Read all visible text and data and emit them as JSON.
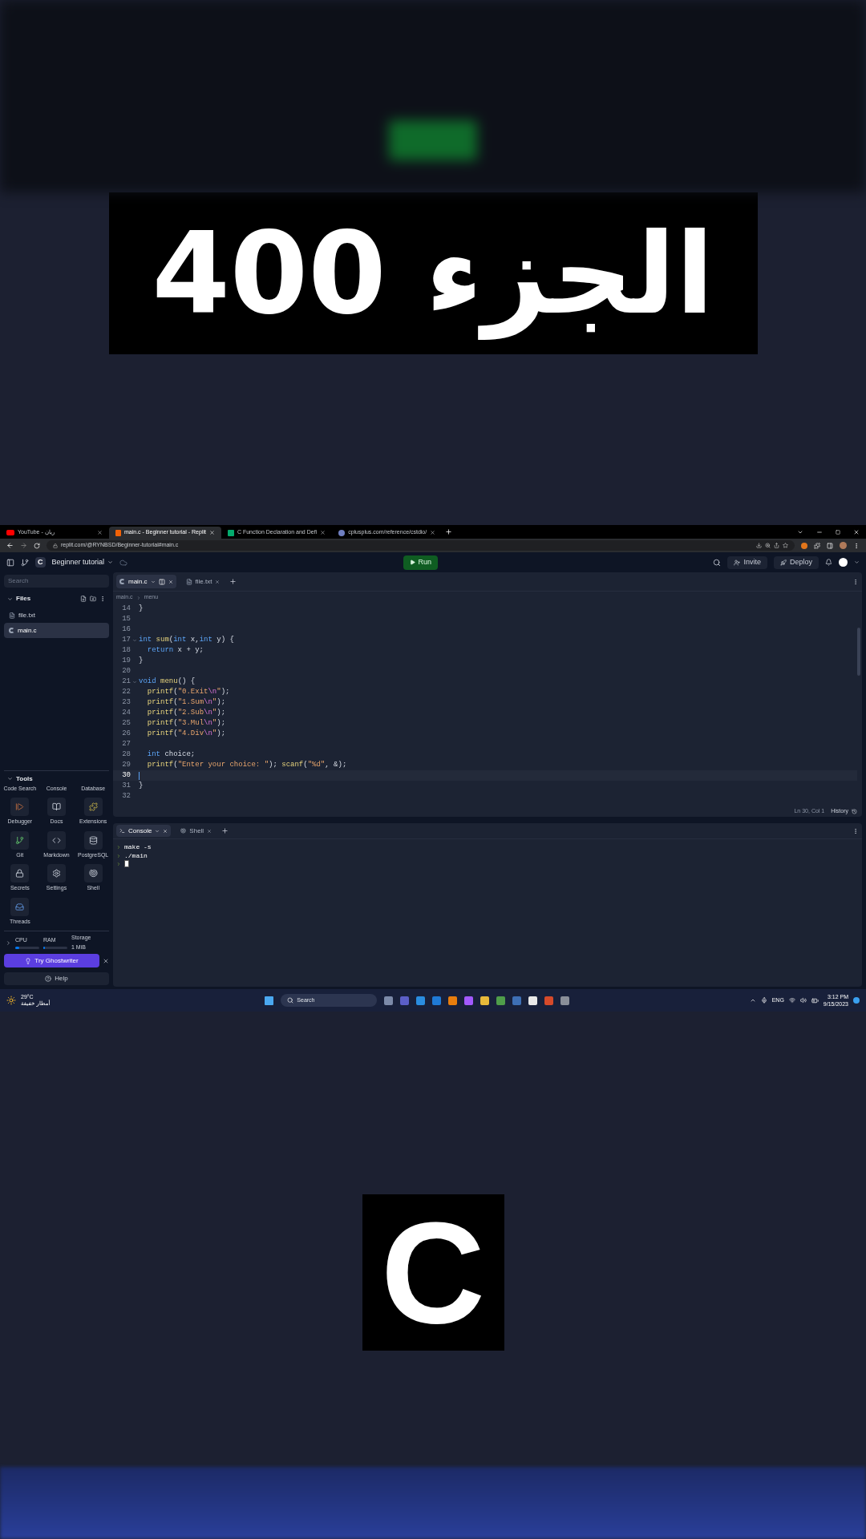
{
  "title_card": {
    "text": "الجزء 400"
  },
  "browser": {
    "tabs": [
      {
        "title": "YouTube - ريان",
        "selected": false,
        "kind": "youtube"
      },
      {
        "title": "main.c - Beginner tutorial - Replit",
        "selected": true,
        "kind": "replit"
      },
      {
        "title": "C Function Declaration and Defi",
        "selected": false,
        "kind": "w3"
      },
      {
        "title": "cplusplus.com/reference/cstdio/",
        "selected": false,
        "kind": "cplusplus"
      }
    ],
    "address": "replit.com/@RYNBSD/Beginner-tutorial#main.c"
  },
  "replit_header": {
    "lang_badge": "C",
    "repl_name": "Beginner tutorial",
    "run": "Run",
    "invite": "Invite",
    "deploy": "Deploy"
  },
  "sidebar": {
    "search_placeholder": "Search",
    "files_title": "Files",
    "files": [
      {
        "name": "file.txt",
        "kind": "text",
        "selected": false
      },
      {
        "name": "main.c",
        "kind": "c",
        "selected": true
      }
    ],
    "tools_title": "Tools",
    "tool_header_labels": [
      "Code Search",
      "Console",
      "Database"
    ],
    "tools": [
      "Debugger",
      "Docs",
      "Extensions",
      "Git",
      "Markdown",
      "PostgreSQL",
      "Secrets",
      "Settings",
      "Shell",
      "Threads"
    ],
    "resources": [
      {
        "label": "CPU",
        "level": 0.15
      },
      {
        "label": "RAM",
        "level": 0.05
      }
    ],
    "storage": {
      "label": "Storage",
      "value": "1 MiB"
    },
    "ghostwriter": "Try Ghostwriter",
    "help": "Help"
  },
  "editor": {
    "tabs": [
      {
        "title": "main.c",
        "kind": "c",
        "selected": true
      },
      {
        "title": "file.txt",
        "kind": "text",
        "selected": false
      }
    ],
    "breadcrumb": [
      "main.c",
      "menu"
    ],
    "lines": [
      {
        "n": "14",
        "selected": false,
        "foldable": false,
        "tokens": [
          {
            "text": "}",
            "kind": "plain"
          }
        ]
      },
      {
        "n": "15",
        "selected": false,
        "foldable": false
      },
      {
        "n": "16",
        "selected": false,
        "foldable": false
      },
      {
        "n": "17",
        "selected": false,
        "foldable": true,
        "tokens": [
          {
            "text": "int",
            "kind": "kw"
          },
          {
            "text": " sum",
            "kind": "fn"
          },
          {
            "text": "(",
            "kind": "plain"
          },
          {
            "text": "int",
            "kind": "kw"
          },
          {
            "text": " x,",
            "kind": "plain"
          },
          {
            "text": "int",
            "kind": "kw"
          },
          {
            "text": " y) {",
            "kind": "plain"
          }
        ]
      },
      {
        "n": "18",
        "selected": false,
        "foldable": false,
        "tokens": [
          {
            "text": "  return",
            "kind": "kw"
          },
          {
            "text": " x + y;",
            "kind": "plain"
          }
        ]
      },
      {
        "n": "19",
        "selected": false,
        "foldable": false,
        "tokens": [
          {
            "text": "}",
            "kind": "plain"
          }
        ]
      },
      {
        "n": "20",
        "selected": false,
        "foldable": false
      },
      {
        "n": "21",
        "selected": false,
        "foldable": true,
        "tokens": [
          {
            "text": "void",
            "kind": "kw"
          },
          {
            "text": " menu",
            "kind": "fn"
          },
          {
            "text": "() {",
            "kind": "plain"
          }
        ]
      },
      {
        "n": "22",
        "selected": false,
        "foldable": false,
        "tokens": [
          {
            "text": "  printf",
            "kind": "fn"
          },
          {
            "text": "(",
            "kind": "plain"
          },
          {
            "text": "\"0.Exit",
            "kind": "str"
          },
          {
            "text": "\\n",
            "kind": "esc"
          },
          {
            "text": "\"",
            "kind": "str"
          },
          {
            "text": ");",
            "kind": "plain"
          }
        ]
      },
      {
        "n": "23",
        "selected": false,
        "foldable": false,
        "tokens": [
          {
            "text": "  printf",
            "kind": "fn"
          },
          {
            "text": "(",
            "kind": "plain"
          },
          {
            "text": "\"1.Sum",
            "kind": "str"
          },
          {
            "text": "\\n",
            "kind": "esc"
          },
          {
            "text": "\"",
            "kind": "str"
          },
          {
            "text": ");",
            "kind": "plain"
          }
        ]
      },
      {
        "n": "24",
        "selected": false,
        "foldable": false,
        "tokens": [
          {
            "text": "  printf",
            "kind": "fn"
          },
          {
            "text": "(",
            "kind": "plain"
          },
          {
            "text": "\"2.Sub",
            "kind": "str"
          },
          {
            "text": "\\n",
            "kind": "esc"
          },
          {
            "text": "\"",
            "kind": "str"
          },
          {
            "text": ");",
            "kind": "plain"
          }
        ]
      },
      {
        "n": "25",
        "selected": false,
        "foldable": false,
        "tokens": [
          {
            "text": "  printf",
            "kind": "fn"
          },
          {
            "text": "(",
            "kind": "plain"
          },
          {
            "text": "\"3.Mul",
            "kind": "str"
          },
          {
            "text": "\\n",
            "kind": "esc"
          },
          {
            "text": "\"",
            "kind": "str"
          },
          {
            "text": ");",
            "kind": "plain"
          }
        ]
      },
      {
        "n": "26",
        "selected": false,
        "foldable": false,
        "tokens": [
          {
            "text": "  printf",
            "kind": "fn"
          },
          {
            "text": "(",
            "kind": "plain"
          },
          {
            "text": "\"4.Div",
            "kind": "str"
          },
          {
            "text": "\\n",
            "kind": "esc"
          },
          {
            "text": "\"",
            "kind": "str"
          },
          {
            "text": ");",
            "kind": "plain"
          }
        ]
      },
      {
        "n": "27",
        "selected": false,
        "foldable": false
      },
      {
        "n": "28",
        "selected": false,
        "foldable": false,
        "tokens": [
          {
            "text": "  int",
            "kind": "kw"
          },
          {
            "text": " choice;",
            "kind": "plain"
          }
        ]
      },
      {
        "n": "29",
        "selected": false,
        "foldable": false,
        "tokens": [
          {
            "text": "  printf",
            "kind": "fn"
          },
          {
            "text": "(",
            "kind": "plain"
          },
          {
            "text": "\"Enter your choice: \"",
            "kind": "str"
          },
          {
            "text": "); ",
            "kind": "plain"
          },
          {
            "text": "scanf",
            "kind": "fn"
          },
          {
            "text": "(",
            "kind": "plain"
          },
          {
            "text": "\"%d\"",
            "kind": "str"
          },
          {
            "text": ", &);",
            "kind": "plain"
          }
        ]
      },
      {
        "n": "30",
        "selected": true,
        "foldable": false
      },
      {
        "n": "31",
        "selected": false,
        "foldable": false,
        "tokens": [
          {
            "text": "}",
            "kind": "plain"
          }
        ]
      },
      {
        "n": "32",
        "selected": false,
        "foldable": false
      }
    ],
    "position": "Ln 30, Col 1",
    "history": "History"
  },
  "console": {
    "tabs": [
      {
        "title": "Console",
        "kind": "console",
        "selected": true
      },
      {
        "title": "Shell",
        "kind": "shell",
        "selected": false
      }
    ],
    "lines": [
      "make -s",
      "./main"
    ]
  },
  "taskbar": {
    "temperature": "29°C",
    "weather": "أمطار خفيفة",
    "search_placeholder": "Search",
    "language": "ENG",
    "time": "3:12 PM",
    "date": "9/15/2023"
  },
  "bottom_card": {
    "text": "C"
  }
}
